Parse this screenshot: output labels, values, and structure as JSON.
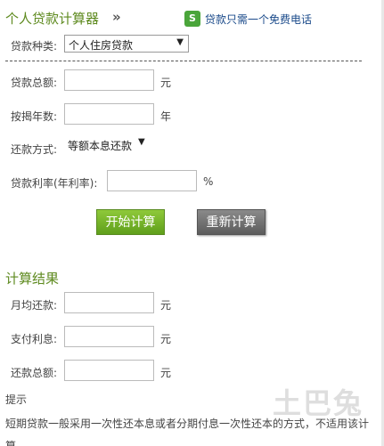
{
  "header": {
    "title": "个人贷款计算器",
    "chevron": "»",
    "phone_icon_glyph": "S",
    "phone_text": "贷款只需一个免费电话"
  },
  "form": {
    "loan_type_label": "贷款种类:",
    "loan_type_value": "个人住房贷款",
    "total_label": "贷款总额:",
    "total_value": "",
    "total_unit": "元",
    "years_label": "按揭年数:",
    "years_value": "",
    "years_unit": "年",
    "method_label": "还款方式:",
    "method_value": "等额本息还款",
    "rate_label": "贷款利率(年利率):",
    "rate_value": "",
    "rate_unit": "%",
    "start_button": "开始计算",
    "reset_button": "重新计算"
  },
  "result": {
    "title": "计算结果",
    "monthly_label": "月均还款:",
    "monthly_value": "",
    "monthly_unit": "元",
    "interest_label": "支付利息:",
    "interest_value": "",
    "interest_unit": "元",
    "total_label": "还款总额:",
    "total_value": "",
    "total_unit": "元"
  },
  "tip": {
    "title": "提示",
    "text": "短期贷款一般采用一次性还本息或者分期付息一次性还本的方式，不适用该计算。"
  },
  "watermark": "土巴兔",
  "colors": {
    "title_green": "#5e8a1f",
    "link_blue": "#1a4a8a",
    "start_button": "#6fae22",
    "reset_button": "#6b6b6b"
  }
}
